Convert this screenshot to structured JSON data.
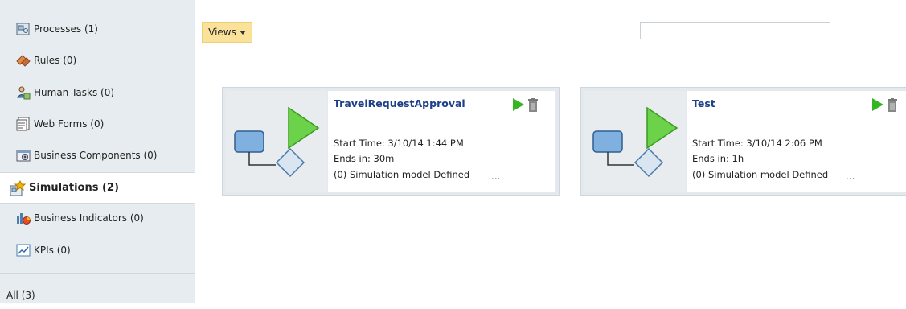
{
  "sidebar": {
    "items": [
      {
        "label": "Processes (1)",
        "icon": "process-icon"
      },
      {
        "label": "Rules (0)",
        "icon": "rules-icon"
      },
      {
        "label": "Human Tasks (0)",
        "icon": "human-task-icon"
      },
      {
        "label": "Web Forms (0)",
        "icon": "web-form-icon"
      },
      {
        "label": "Business Components (0)",
        "icon": "business-component-icon"
      },
      {
        "label": "Simulations (2)",
        "icon": "simulation-icon",
        "active": true
      },
      {
        "label": "Business Indicators (0)",
        "icon": "business-indicator-icon"
      },
      {
        "label": "KPIs (0)",
        "icon": "kpi-icon"
      },
      {
        "label": "All (3)",
        "icon": ""
      }
    ]
  },
  "toolbar": {
    "views_label": "Views",
    "search_placeholder": ""
  },
  "cards": [
    {
      "title": "TravelRequestApproval",
      "start_time": "Start Time: 3/10/14 1:44 PM",
      "ends_in": "Ends in: 30m",
      "model": "(0) Simulation model Defined",
      "more": "..."
    },
    {
      "title": "Test",
      "start_time": "Start Time: 3/10/14 2:06 PM",
      "ends_in": "Ends in: 1h",
      "model": "(0) Simulation model Defined",
      "more": "..."
    }
  ],
  "colors": {
    "sidebar_bg": "#e6ecef",
    "views_bg": "#fbe29a",
    "title_blue": "#1e3f87",
    "play_green": "#35b521"
  }
}
